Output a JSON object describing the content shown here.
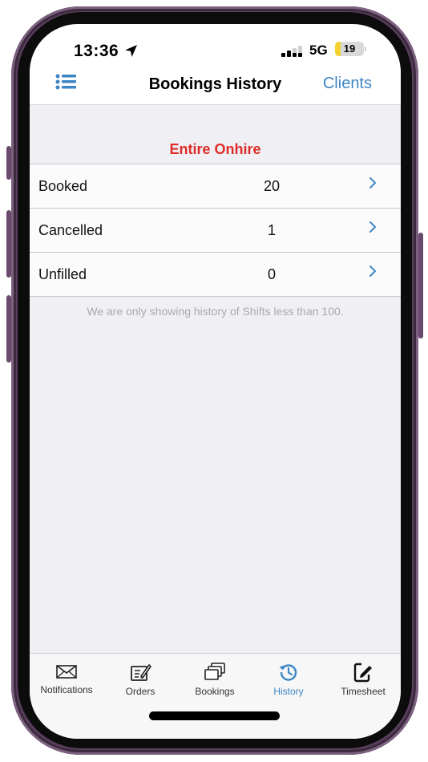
{
  "status_bar": {
    "time": "13:36",
    "network": "5G",
    "battery_level": "19"
  },
  "nav": {
    "title": "Bookings History",
    "right_label": "Clients"
  },
  "section": {
    "title": "Entire Onhire"
  },
  "rows": [
    {
      "label": "Booked",
      "value": "20"
    },
    {
      "label": "Cancelled",
      "value": "1"
    },
    {
      "label": "Unfilled",
      "value": "0"
    }
  ],
  "note": "We are only showing history of Shifts less than 100.",
  "tabs": [
    {
      "label": "Notifications",
      "icon": "envelope-icon"
    },
    {
      "label": "Orders",
      "icon": "pen-tablet-icon"
    },
    {
      "label": "Bookings",
      "icon": "stacked-cards-icon"
    },
    {
      "label": "History",
      "icon": "history-icon",
      "active": true
    },
    {
      "label": "Timesheet",
      "icon": "edit-document-icon"
    }
  ],
  "colors": {
    "accent": "#3d86c6",
    "section_title": "#dd2c27",
    "background": "#efeff4",
    "frame": "#5b3f5f"
  }
}
